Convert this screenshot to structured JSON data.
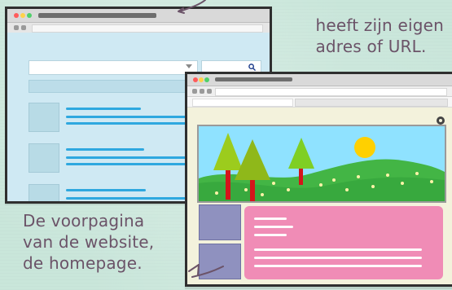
{
  "annotations": {
    "top_right_text": "heeft zijn eigen\nadres of URL.",
    "bottom_left_text": "De voorpagina\nvan de website,\nde homepage."
  },
  "colors": {
    "background": "#c9e6da",
    "text": "#6b5368",
    "window1_bg": "#cfe9f3",
    "window2_bg": "#f3f2dc",
    "link_line": "#2ea8df",
    "hero_sky": "#8fe2ff",
    "hero_grass": "#43b545",
    "hero_sun": "#ffd000",
    "tile_purple": "#8f91bf",
    "card_pink": "#f08cb6"
  },
  "icons": {
    "traffic_lights": [
      "close-dot",
      "minimize-dot",
      "maximize-dot"
    ],
    "nav": [
      "back-icon",
      "forward-icon",
      "home-icon"
    ],
    "search": "search-icon",
    "settings": "gear-icon"
  }
}
